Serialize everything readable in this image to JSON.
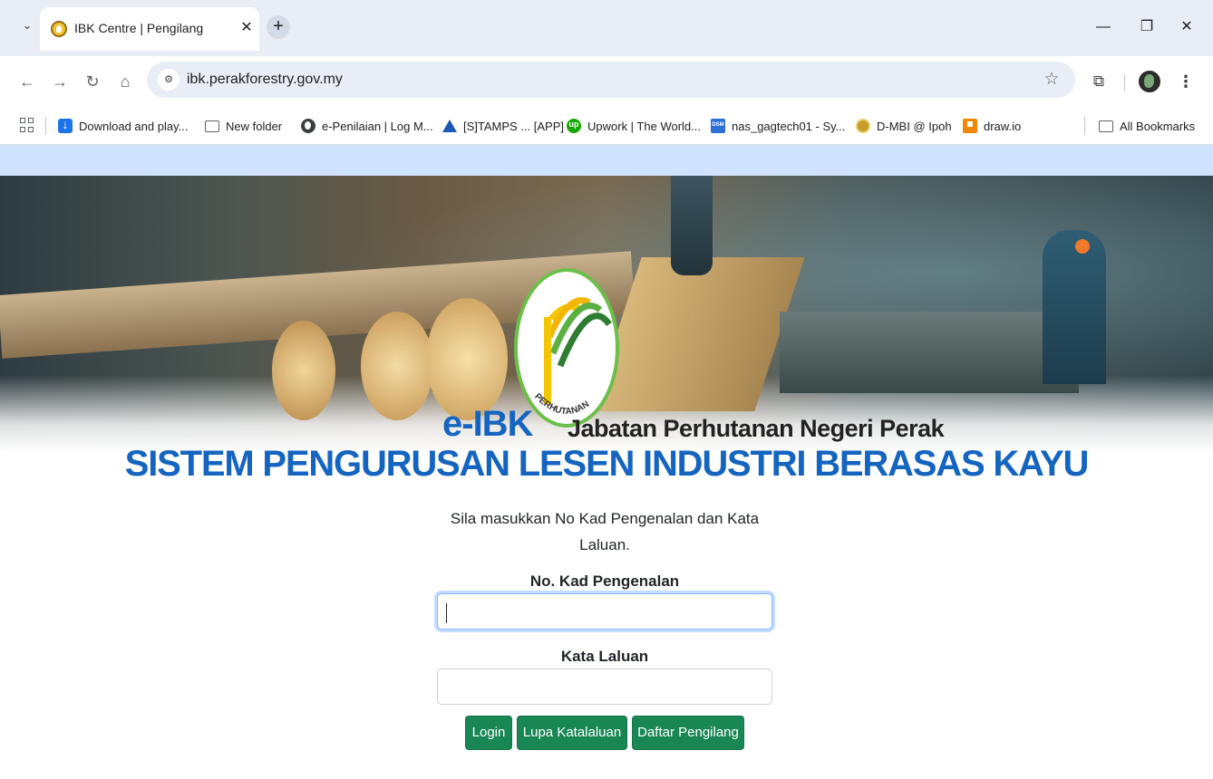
{
  "browser": {
    "tab_title": "IBK Centre | Pengilang",
    "url": "ibk.perakforestry.gov.my",
    "bookmarks": [
      {
        "label": "Download and play...",
        "icon": "download-icon"
      },
      {
        "label": "New folder",
        "icon": "folder-icon"
      },
      {
        "label": "e-Penilaian | Log M...",
        "icon": "globe-icon"
      },
      {
        "label": "[S]TAMPS ... [APP]",
        "icon": "stamps-icon"
      },
      {
        "label": "Upwork | The World...",
        "icon": "upwork-icon"
      },
      {
        "label": "nas_gagtech01 - Sy...",
        "icon": "dsm-icon"
      },
      {
        "label": "D-MBI @ Ipoh",
        "icon": "dmbi-icon"
      },
      {
        "label": "draw.io",
        "icon": "drawio-icon"
      }
    ],
    "all_bookmarks_label": "All Bookmarks"
  },
  "header": {
    "logo_short": "e-IBK",
    "logo_ring_text": "PERHUTANAN",
    "department": "Jabatan Perhutanan Negeri Perak",
    "system_title": "SISTEM PENGURUSAN LESEN INDUSTRI BERASAS KAYU"
  },
  "login": {
    "instruction_line1": "Sila masukkan No Kad Pengenalan dan Kata",
    "instruction_line2": "Laluan.",
    "id_label": "No. Kad Pengenalan",
    "id_value": "",
    "password_label": "Kata Laluan",
    "password_value": "",
    "login_button": "Login",
    "forgot_button": "Lupa Katalaluan",
    "register_button": "Daftar Pengilang"
  },
  "colors": {
    "brand_blue": "#1565c0",
    "button_green": "#198754",
    "strip_blue": "#cfe2ff",
    "logo_green": "#2e9e3f"
  }
}
